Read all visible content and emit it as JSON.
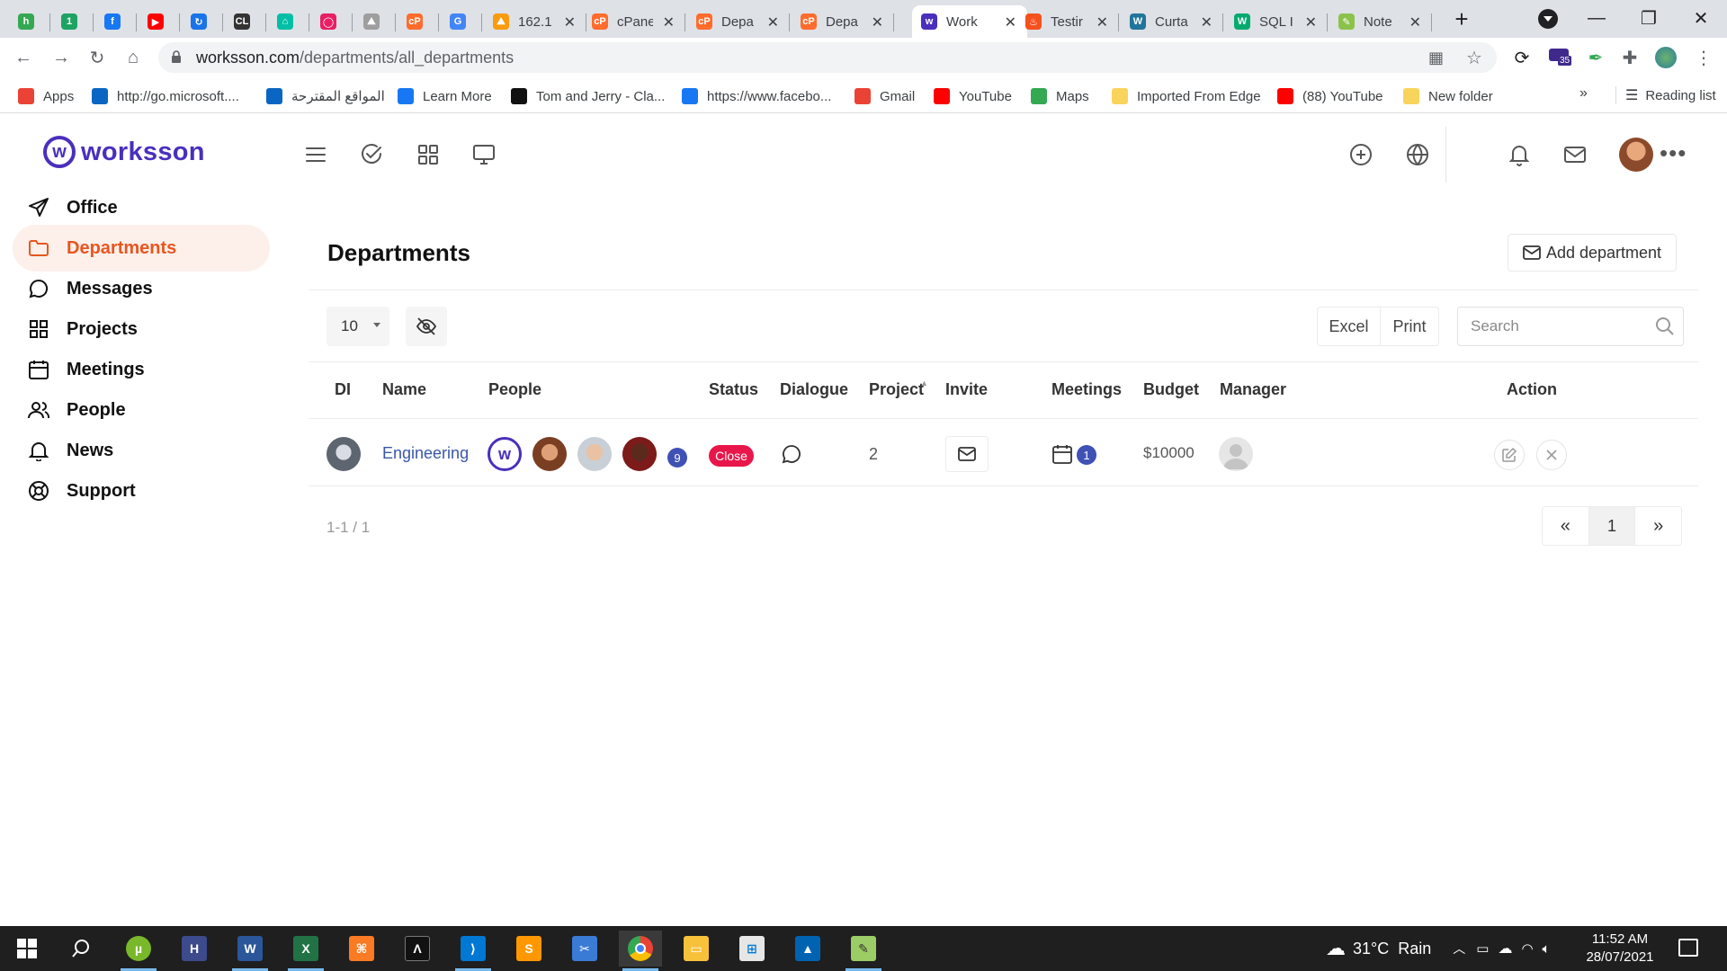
{
  "browser": {
    "tabs": [
      {
        "icon": "green-circle-icon",
        "color": "#34a853",
        "glyph": "h",
        "title": ""
      },
      {
        "icon": "green-circle-icon",
        "color": "#1ea362",
        "glyph": "1",
        "title": ""
      },
      {
        "icon": "facebook-icon",
        "color": "#1877f2",
        "glyph": "f",
        "title": ""
      },
      {
        "icon": "youtube-icon",
        "color": "#ff0000",
        "glyph": "▶",
        "title": ""
      },
      {
        "icon": "blue-swirl-icon",
        "color": "#1a73e8",
        "glyph": "↻",
        "title": ""
      },
      {
        "icon": "cl-icon",
        "color": "#333333",
        "glyph": "CL",
        "title": ""
      },
      {
        "icon": "house-icon",
        "color": "#00bfa5",
        "glyph": "⌂",
        "title": ""
      },
      {
        "icon": "ring-icon",
        "color": "#e91e63",
        "glyph": "◯",
        "title": ""
      },
      {
        "icon": "pma-icon",
        "color": "#9e9e9e",
        "glyph": "⛰",
        "title": ""
      },
      {
        "icon": "cpanel-icon",
        "color": "#ff6c2c",
        "glyph": "cP",
        "title": ""
      },
      {
        "icon": "google-icon",
        "color": "#4285f4",
        "glyph": "G",
        "title": ""
      },
      {
        "icon": "pma-icon",
        "color": "#f89c0e",
        "glyph": "⛰",
        "title": "162.1"
      },
      {
        "icon": "cpanel-icon",
        "color": "#ff6c2c",
        "glyph": "cP",
        "title": "cPane"
      },
      {
        "icon": "cpanel-icon",
        "color": "#ff6c2c",
        "glyph": "cP",
        "title": "Depa"
      },
      {
        "icon": "cpanel-icon",
        "color": "#ff6c2c",
        "glyph": "cP",
        "title": "Depa"
      },
      {
        "icon": "worksson-icon",
        "color": "#4a2fbd",
        "glyph": "w",
        "title": "Work"
      },
      {
        "icon": "flame-icon",
        "color": "#f4511e",
        "glyph": "♨",
        "title": "Testir"
      },
      {
        "icon": "wordpress-icon",
        "color": "#21759b",
        "glyph": "W",
        "title": "Curta"
      },
      {
        "icon": "w3schools-icon",
        "color": "#04aa6d",
        "glyph": "W",
        "title": "SQL I"
      },
      {
        "icon": "notepad-icon",
        "color": "#8bc34a",
        "glyph": "✎",
        "title": "Note"
      }
    ],
    "url_host": "worksson.com",
    "url_path": "/departments/all_departments",
    "extension_badge": "35",
    "bookmarks": [
      {
        "icon": "apps-grid-icon",
        "color": "#ea4335",
        "label": "Apps"
      },
      {
        "icon": "bing-icon",
        "color": "#0a66c2",
        "label": "http://go.microsoft...."
      },
      {
        "icon": "bing-icon",
        "color": "#0a66c2",
        "label": "المواقع المقترحة"
      },
      {
        "icon": "facebook-icon",
        "color": "#1877f2",
        "label": "Learn More"
      },
      {
        "icon": "prime-icon",
        "color": "#111111",
        "label": "Tom and Jerry - Cla..."
      },
      {
        "icon": "facebook-icon",
        "color": "#1877f2",
        "label": "https://www.facebo..."
      },
      {
        "icon": "gmail-icon",
        "color": "#ea4335",
        "label": "Gmail"
      },
      {
        "icon": "youtube-icon",
        "color": "#ff0000",
        "label": "YouTube"
      },
      {
        "icon": "maps-icon",
        "color": "#34a853",
        "label": "Maps"
      },
      {
        "icon": "folder-icon",
        "color": "#f9d45c",
        "label": "Imported From Edge"
      },
      {
        "icon": "youtube-icon",
        "color": "#ff0000",
        "label": "(88) YouTube"
      },
      {
        "icon": "folder-icon",
        "color": "#f9d45c",
        "label": "New folder"
      }
    ],
    "overflow": "»",
    "reading_list": "Reading list"
  },
  "app": {
    "brand": "worksson",
    "brand_color": "#4a2fbd",
    "accent_color": "#e8561f",
    "nav": [
      {
        "icon": "send-icon",
        "label": "Office",
        "active": false
      },
      {
        "icon": "folder-icon",
        "label": "Departments",
        "active": true
      },
      {
        "icon": "chat-bubble-icon",
        "label": "Messages",
        "active": false
      },
      {
        "icon": "grid-icon",
        "label": "Projects",
        "active": false
      },
      {
        "icon": "calendar-icon",
        "label": "Meetings",
        "active": false
      },
      {
        "icon": "people-icon",
        "label": "People",
        "active": false
      },
      {
        "icon": "bell-icon",
        "label": "News",
        "active": false
      },
      {
        "icon": "lifebuoy-icon",
        "label": "Support",
        "active": false
      }
    ],
    "page_title": "Departments",
    "add_department": "Add department",
    "page_size": "10",
    "excel": "Excel",
    "print": "Print",
    "search_placeholder": "Search",
    "columns": [
      "DI",
      "Name",
      "People",
      "Status",
      "Dialogue",
      "Project",
      "Invite",
      "Meetings",
      "Budget",
      "Manager",
      "Action"
    ],
    "rows": [
      {
        "name": "Engineering",
        "people_extra": "9",
        "status": "Close",
        "projects": "2",
        "meetings": "1",
        "budget": "$10000"
      }
    ],
    "footer_count": "1-1 / 1",
    "pager": {
      "prev": "«",
      "current": "1",
      "next": "»"
    }
  },
  "taskbar": {
    "weather_temp": "31°C",
    "weather_text": "Rain",
    "time": "11:52 AM",
    "date": "28/07/2021"
  }
}
